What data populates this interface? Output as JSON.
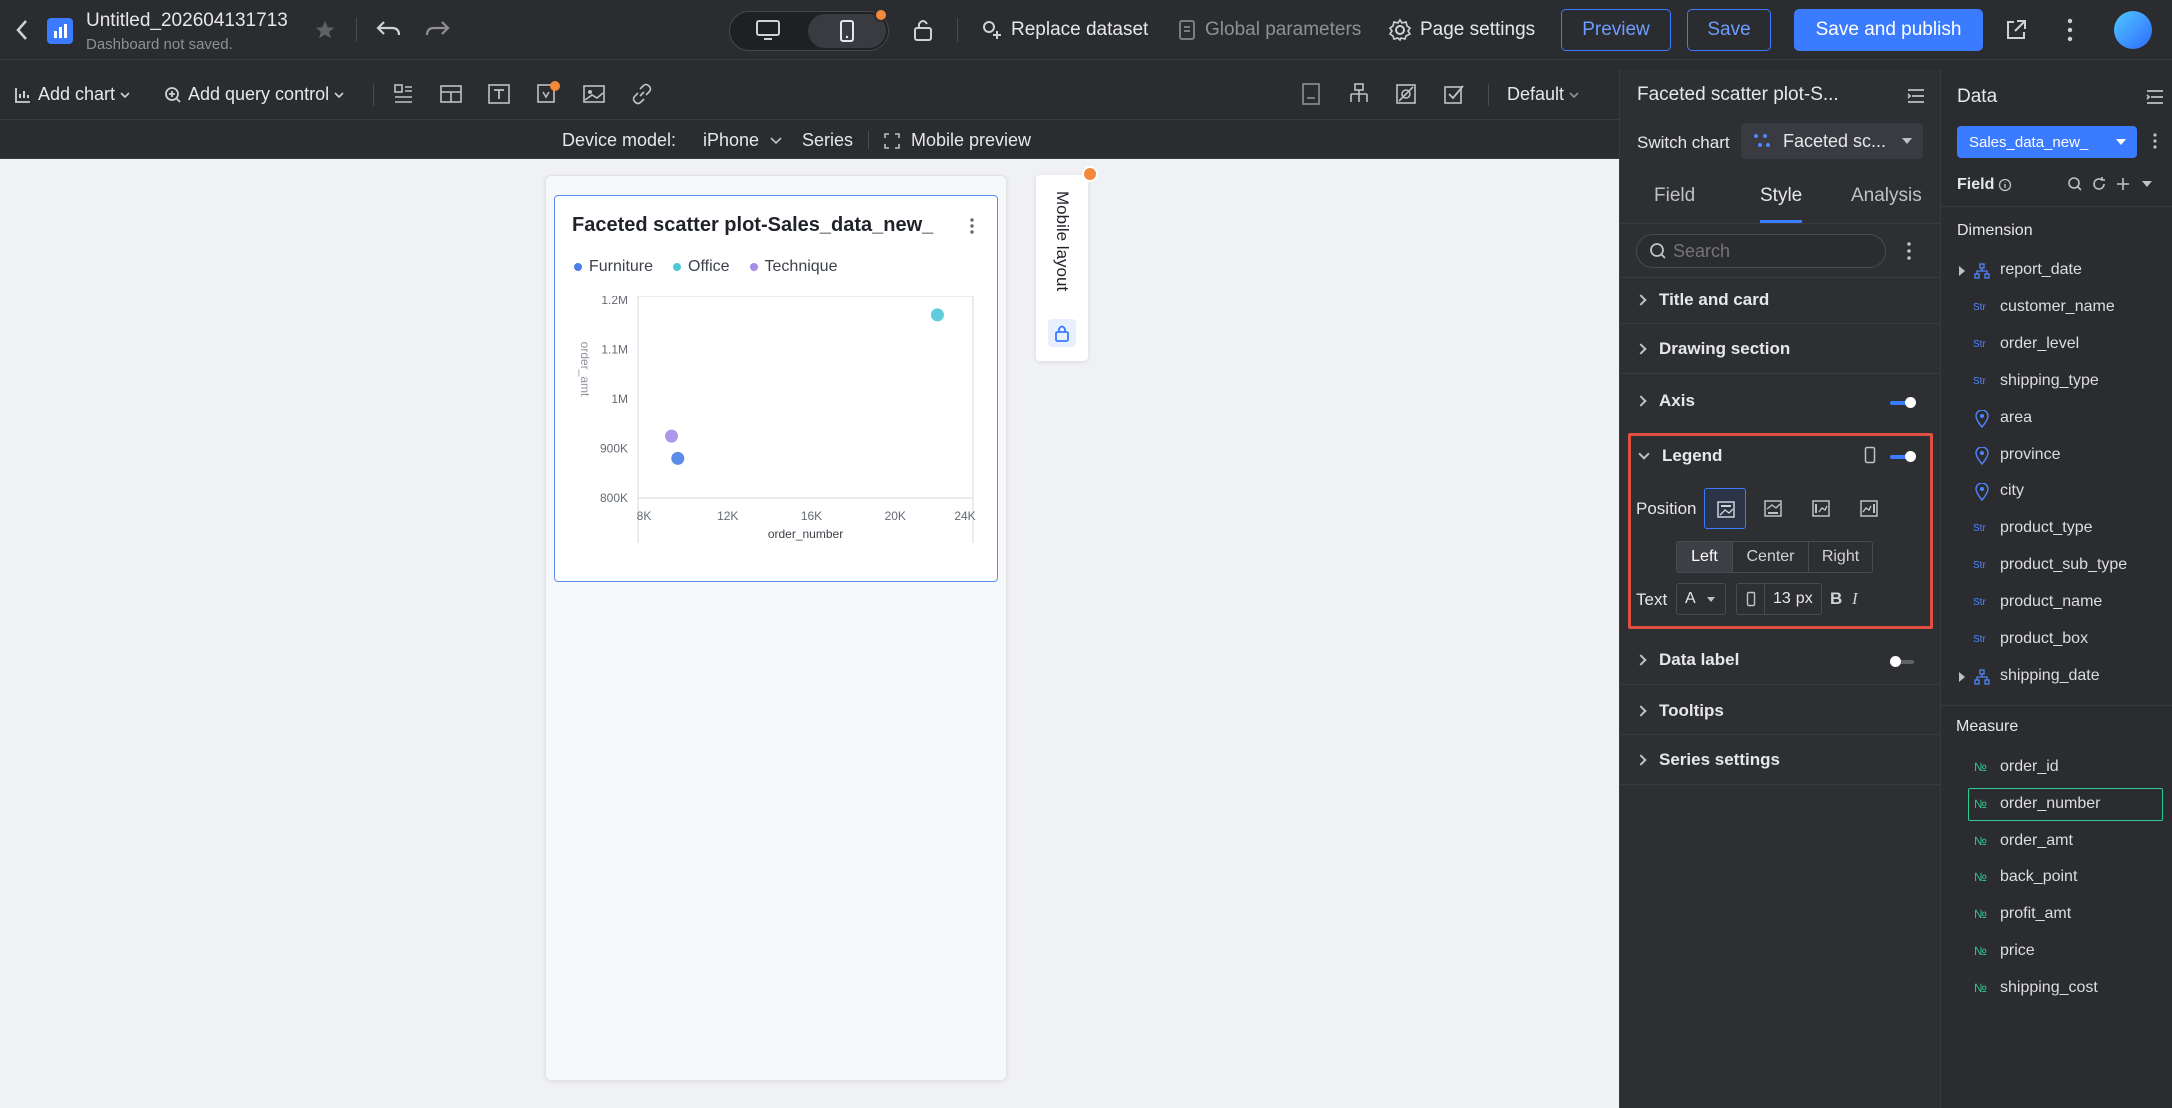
{
  "topbar": {
    "title": "Untitled_202604131713",
    "subtitle": "Dashboard not saved.",
    "replace_dataset": "Replace dataset",
    "global_parameters": "Global parameters",
    "page_settings": "Page settings",
    "preview": "Preview",
    "save": "Save",
    "save_publish": "Save and publish",
    "accent": "#3a7bff"
  },
  "toolbar": {
    "add_chart": "Add chart",
    "add_query": "Add query control",
    "theme": "Default"
  },
  "devicebar": {
    "device_model_label": "Device model:",
    "device_model": "iPhone",
    "series": "Series",
    "mobile_preview": "Mobile preview"
  },
  "mobile_layout": "Mobile layout",
  "card": {
    "title": "Faceted scatter plot-Sales_data_new_",
    "legend": [
      {
        "name": "Furniture",
        "color": "#4a7fe8"
      },
      {
        "name": "Office",
        "color": "#4fc7d8"
      },
      {
        "name": "Technique",
        "color": "#a48ce8"
      }
    ]
  },
  "chart_data": {
    "type": "scatter",
    "xlabel": "order_number",
    "ylabel": "order_amt",
    "xticks": [
      "8K",
      "12K",
      "16K",
      "20K",
      "24K"
    ],
    "yticks": [
      "800K",
      "900K",
      "1M",
      "1.1M",
      "1.2M"
    ],
    "xlim": [
      8000,
      24000
    ],
    "ylim": [
      800000,
      1200000
    ],
    "series": [
      {
        "name": "Furniture",
        "color": "#4a7fe8",
        "points": [
          [
            9900,
            880000
          ]
        ]
      },
      {
        "name": "Office",
        "color": "#4fc7d8",
        "points": [
          [
            22300,
            1170000
          ]
        ]
      },
      {
        "name": "Technique",
        "color": "#a48ce8",
        "points": [
          [
            9600,
            925000
          ]
        ]
      }
    ]
  },
  "style": {
    "panel_title": "Faceted scatter plot-S...",
    "switch_chart_label": "Switch chart",
    "switch_chart_value": "Faceted sc...",
    "tabs": [
      "Field",
      "Style",
      "Analysis"
    ],
    "active_tab": "Style",
    "search_placeholder": "Search",
    "sections": {
      "title_card": "Title and card",
      "drawing": "Drawing section",
      "axis": "Axis",
      "legend": "Legend",
      "data_label": "Data label",
      "tooltips": "Tooltips",
      "series_settings": "Series settings"
    },
    "legend": {
      "position_label": "Position",
      "align": [
        "Left",
        "Center",
        "Right"
      ],
      "active_align": "Left",
      "text_label": "Text",
      "font_color": "A",
      "font_size": "13",
      "font_unit": "px",
      "bold": "B",
      "italic": "I"
    },
    "highlight": "#e05040"
  },
  "data": {
    "title": "Data",
    "dataset": "Sales_data_new_",
    "field_label": "Field",
    "dimension_label": "Dimension",
    "measure_label": "Measure",
    "dimensions": [
      {
        "name": "report_date",
        "type": "date",
        "tag": ""
      },
      {
        "name": "customer_name",
        "type": "str",
        "tag": "Str"
      },
      {
        "name": "order_level",
        "type": "str",
        "tag": "Str"
      },
      {
        "name": "shipping_type",
        "type": "str",
        "tag": "Str"
      },
      {
        "name": "area",
        "type": "geo",
        "tag": ""
      },
      {
        "name": "province",
        "type": "geo",
        "tag": ""
      },
      {
        "name": "city",
        "type": "geo",
        "tag": ""
      },
      {
        "name": "product_type",
        "type": "str",
        "tag": "Str"
      },
      {
        "name": "product_sub_type",
        "type": "str",
        "tag": "Str"
      },
      {
        "name": "product_name",
        "type": "str",
        "tag": "Str"
      },
      {
        "name": "product_box",
        "type": "str",
        "tag": "Str"
      },
      {
        "name": "shipping_date",
        "type": "date",
        "tag": ""
      }
    ],
    "measures": [
      {
        "name": "order_id",
        "tag": "№"
      },
      {
        "name": "order_number",
        "tag": "№"
      },
      {
        "name": "order_amt",
        "tag": "№"
      },
      {
        "name": "back_point",
        "tag": "№"
      },
      {
        "name": "profit_amt",
        "tag": "№"
      },
      {
        "name": "price",
        "tag": "№"
      },
      {
        "name": "shipping_cost",
        "tag": "№"
      }
    ],
    "selected_measure": "order_number"
  }
}
